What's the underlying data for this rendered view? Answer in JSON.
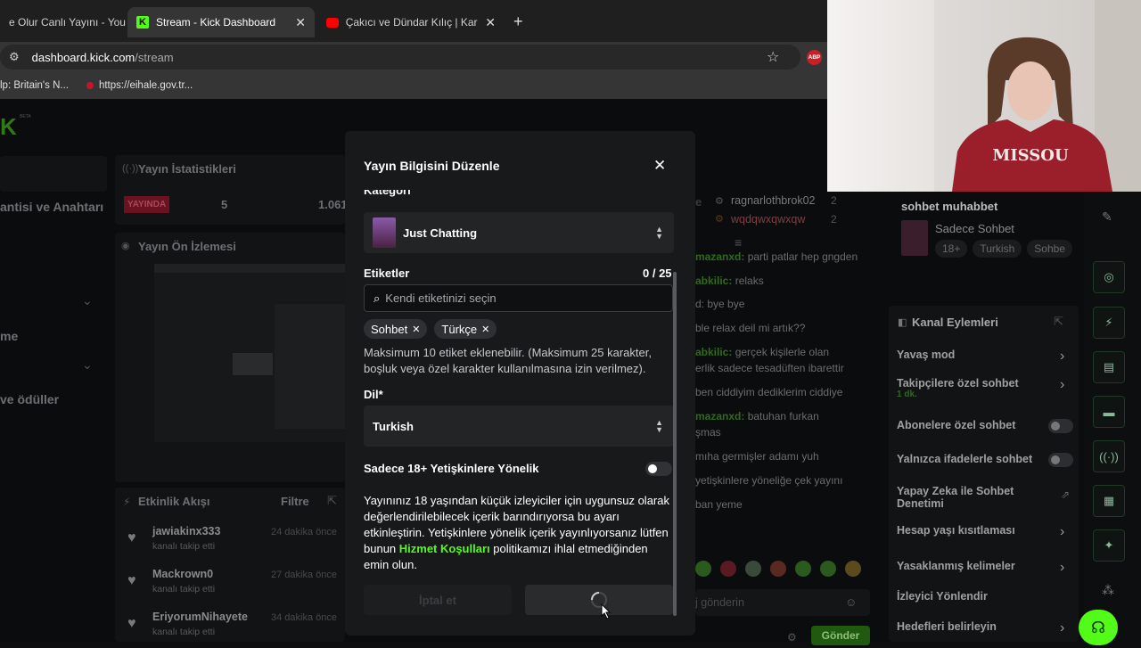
{
  "browser": {
    "tabs": [
      {
        "title": "e Olur Canlı Yayını - You"
      },
      {
        "title": "Stream - Kick Dashboard"
      },
      {
        "title": "Çakıcı ve Dündar Kılıç | Karanlık"
      }
    ],
    "url_host": "dashboard.kick.com",
    "url_path": "/stream",
    "bookmarks": [
      "lp: Britain's N...",
      "https://eihale.gov.tr..."
    ],
    "extension_label": "ABP"
  },
  "background": {
    "logo_badge": "BETA",
    "left_nav": [
      "antisi ve Anahtarı",
      "me",
      "ve ödüller"
    ],
    "stats_title": "Yayın İstatistikleri",
    "live_badge": "YAYINDA",
    "stat_viewers": "5",
    "stat_followers": "1.061",
    "preview_title": "Yayın Ön İzlemesi",
    "activity_title": "Etkinlik Akışı",
    "activity_filter": "Filtre",
    "activity": [
      {
        "user": "jawiakinx333",
        "action": "kanalı takip etti",
        "time": "24 dakika önce"
      },
      {
        "user": "Mackrown0",
        "action": "kanalı takip etti",
        "time": "27 dakika önce"
      },
      {
        "user": "EriyorumNihayete",
        "action": "kanalı takip etti",
        "time": "34 dakika önce"
      }
    ],
    "chat_users": [
      "ragnarlothbrok02",
      "wqdqwxqwxqw"
    ],
    "chat_user_count": "2",
    "chat": [
      {
        "user": "mazanxd:",
        "msg": "parti patlar hep gngden"
      },
      {
        "user": "abkilic:",
        "msg": "relaks"
      },
      {
        "user": "",
        "msg": "d: bye bye"
      },
      {
        "user": "",
        "msg": "ble relax deil mi artık??"
      },
      {
        "user": "abkilic:",
        "msg": "gerçek kişilerle olan"
      },
      {
        "user": "",
        "msg": "erlik sadece tesadüften ibarettir"
      },
      {
        "user": "",
        "msg": "ben ciddiyim dediklerim ciddiye"
      },
      {
        "user": "mazanxd:",
        "msg": "batuhan furkan"
      },
      {
        "user": "",
        "msg": "şmas"
      },
      {
        "user": "",
        "msg": "mıha germişler adamı yuh"
      },
      {
        "user": "",
        "msg": "yetişkinlere yöneliğe çek yayını"
      },
      {
        "user": "",
        "msg": "ban yeme"
      }
    ],
    "chat_placeholder": "j gönderin",
    "chat_send": "Gönder",
    "right_title": "sohbet muhabbet",
    "right_category": "Sadece Sohbet",
    "right_tags": [
      "18+",
      "Turkish",
      "Sohbe"
    ],
    "channel_actions_title": "Kanal Eylemleri",
    "channel_actions": [
      {
        "label": "Yavaş mod",
        "kind": "chevron"
      },
      {
        "label": "Takipçilere özel sohbet",
        "sub": "1 dk.",
        "kind": "chevron"
      },
      {
        "label": "Abonelere özel sohbet",
        "kind": "toggle"
      },
      {
        "label": "Yalnızca ifadelerle sohbet",
        "kind": "toggle"
      },
      {
        "label": "Yapay Zeka ile Sohbet Denetimi",
        "kind": "external"
      },
      {
        "label": "Hesap yaşı kısıtlaması",
        "kind": "chevron"
      },
      {
        "label": "Yasaklanmış kelimeler",
        "kind": "chevron"
      },
      {
        "label": "İzleyici Yönlendir",
        "kind": "none"
      },
      {
        "label": "Hedefleri belirleyin",
        "kind": "chevron"
      }
    ]
  },
  "modal": {
    "title": "Yayın Bilgisini Düzenle",
    "category_label": "Kategori",
    "category_value": "Just Chatting",
    "tags_label": "Etiketler",
    "tags_count": "0 / 25",
    "tags_placeholder": "Kendi etiketinizi seçin",
    "tags": [
      "Sohbet",
      "Türkçe"
    ],
    "tags_help": "Maksimum 10 etiket eklenebilir. (Maksimum 25 karakter, boşluk veya özel karakter kullanılmasına izin verilmez).",
    "language_label": "Dil*",
    "language_value": "Turkish",
    "adult_label": "Sadece 18+ Yetişkinlere Yönelik",
    "adult_enabled": false,
    "adult_help_before": "Yayınınız 18 yaşından küçük izleyiciler için uygunsuz olarak değerlendirilebilecek içerik barındırıyorsa bu ayarı etkinleştirin. Yetişkinlere yönelik içerik yayınlıyorsanız lütfen bunun ",
    "adult_help_link": "Hizmet Koşulları",
    "adult_help_after": " politikamızı ihlal etmediğinden emin olun.",
    "cancel_label": "İptal et"
  },
  "colors": {
    "kick_green": "#53fc18",
    "live_red": "#e0283e",
    "link_green": "#53fc18"
  }
}
